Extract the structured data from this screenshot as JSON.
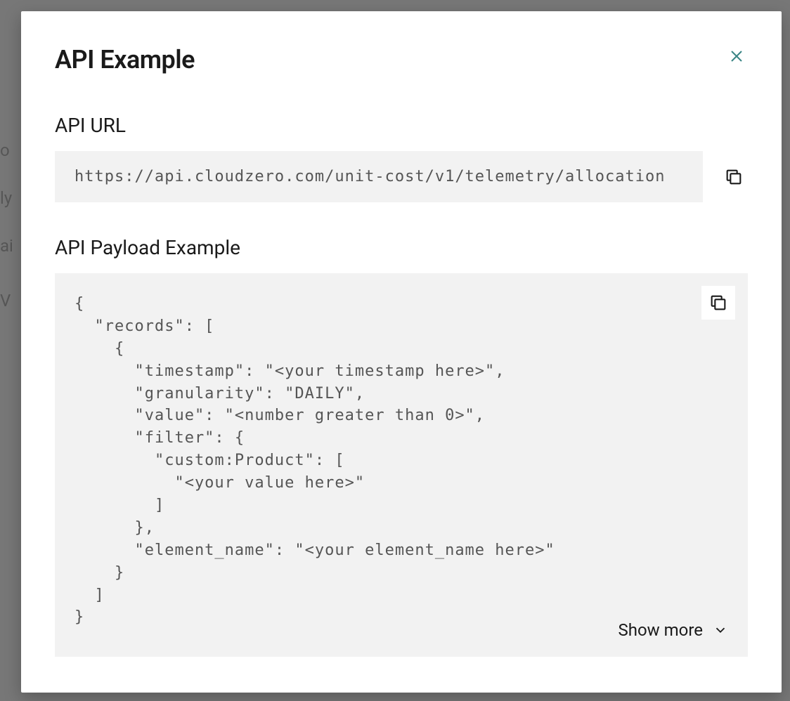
{
  "modal": {
    "title": "API Example",
    "close_aria": "Close",
    "sections": {
      "url": {
        "label": "API URL",
        "value": "https://api.cloudzero.com/unit-cost/v1/telemetry/allocation",
        "copy_aria": "Copy URL"
      },
      "payload": {
        "label": "API Payload Example",
        "code": "{\n  \"records\": [\n    {\n      \"timestamp\": \"<your timestamp here>\",\n      \"granularity\": \"DAILY\",\n      \"value\": \"<number greater than 0>\",\n      \"filter\": {\n        \"custom:Product\": [\n          \"<your value here>\"\n        ]\n      },\n      \"element_name\": \"<your element_name here>\"\n    }\n  ]\n}",
        "copy_aria": "Copy payload",
        "show_more_label": "Show more"
      }
    }
  },
  "background": {
    "hints": [
      "o",
      "ly",
      "ai",
      "V"
    ]
  }
}
